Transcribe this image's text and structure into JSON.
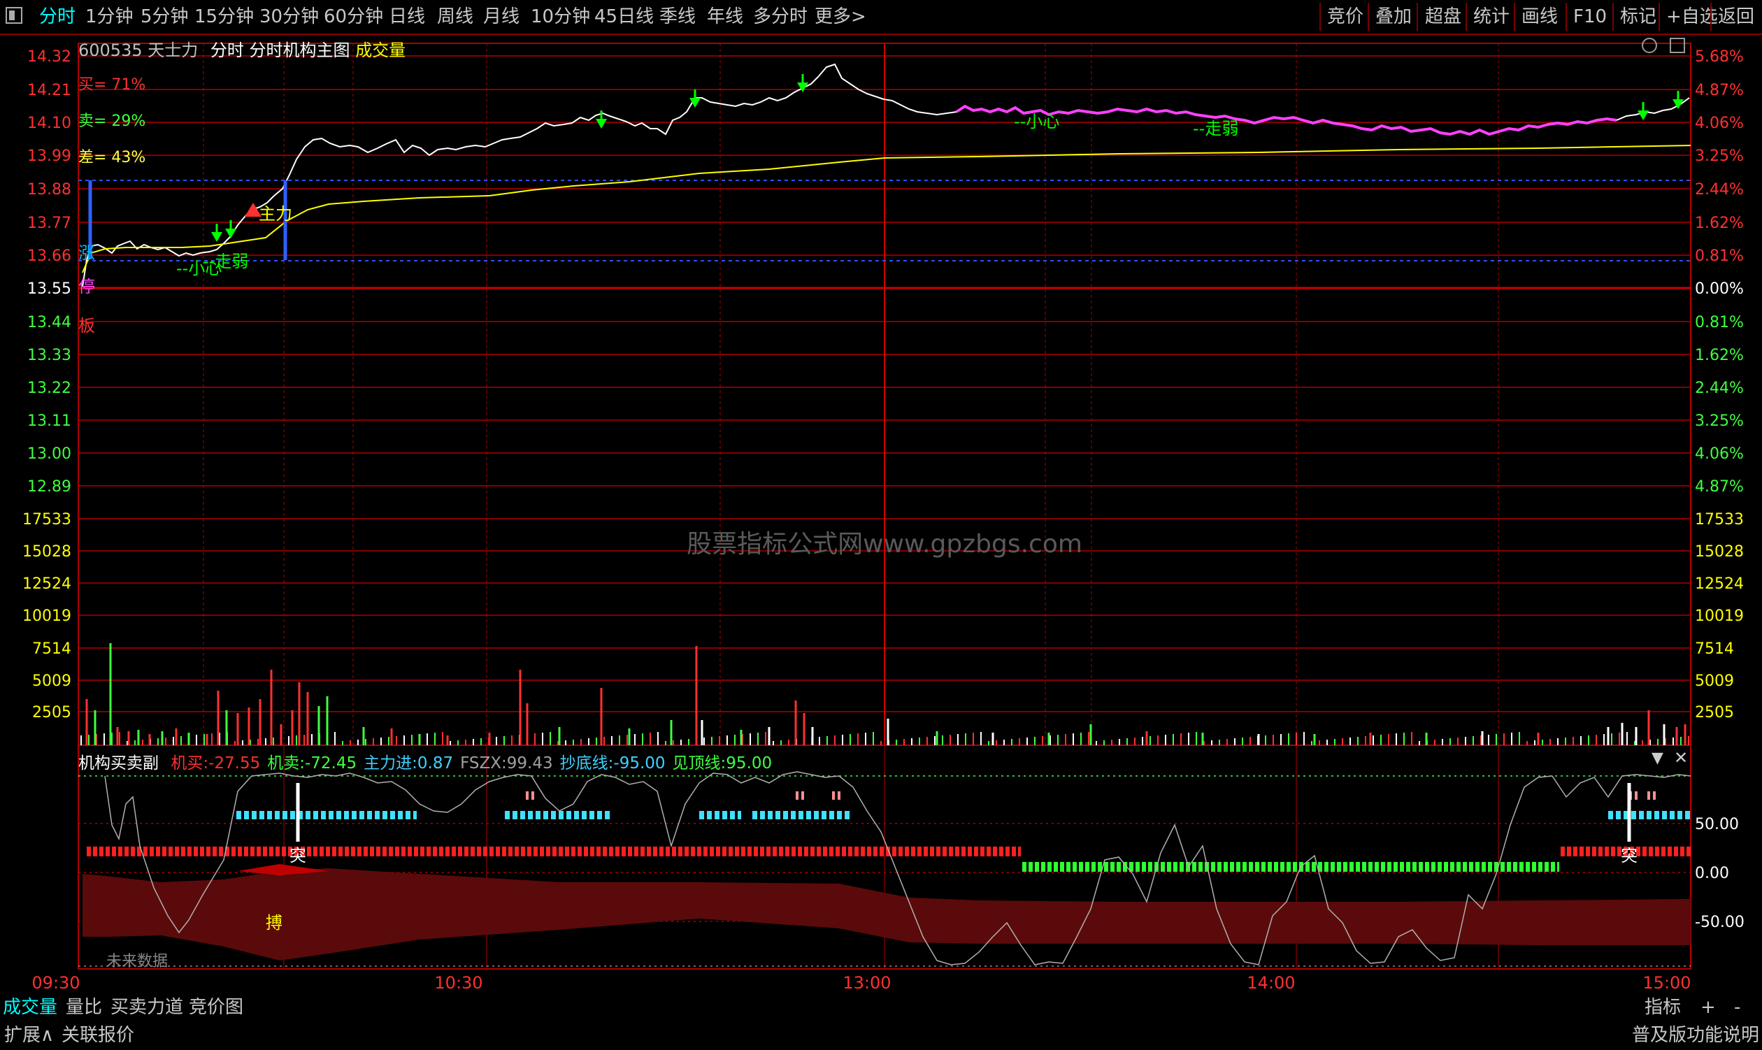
{
  "toolbar": {
    "periods": [
      "分时",
      "1分钟",
      "5分钟",
      "15分钟",
      "30分钟",
      "60分钟",
      "日线",
      "周线",
      "月线",
      "10分钟",
      "45日线",
      "季线",
      "年线",
      "多分时",
      "更多>"
    ],
    "right_buttons": [
      "竞价",
      "叠加",
      "超盘",
      "统计",
      "画线",
      "F10",
      "标记",
      "+自选",
      "返回"
    ]
  },
  "header": {
    "code": "600535",
    "name": "天士力",
    "mode": "分时",
    "indicator_name": "分时机构主图",
    "volume_label": "成交量"
  },
  "main_chart": {
    "stats": [
      {
        "text": "买= 71%",
        "color": "#ff3030"
      },
      {
        "text": "卖= 29%",
        "color": "#40ff40"
      },
      {
        "text": "差= 43%",
        "color": "#ffff40"
      }
    ],
    "price_ticks": [
      "14.32",
      "14.21",
      "14.10",
      "13.99",
      "13.88",
      "13.77",
      "13.66",
      "13.55",
      "13.44",
      "13.33",
      "13.22",
      "13.11",
      "13.00",
      "12.89"
    ],
    "pct_ticks": [
      "5.68%",
      "4.87%",
      "4.06%",
      "3.25%",
      "2.44%",
      "1.62%",
      "0.81%",
      "0.00%",
      "0.81%",
      "1.62%",
      "2.44%",
      "3.25%",
      "4.06%",
      "4.87%"
    ],
    "price_range": [
      12.89,
      14.32
    ],
    "prev_close": 13.55,
    "annotations": [
      {
        "text": "--小心",
        "color": "#00ff00"
      },
      {
        "text": "--走弱",
        "color": "#00ff00"
      },
      {
        "text": "主力",
        "color": "#ffff00"
      },
      {
        "text": "--小心",
        "color": "#00ff00"
      },
      {
        "text": "--走弱",
        "color": "#00ff00"
      }
    ],
    "side_marks": [
      {
        "text": "涨",
        "color": "#00c0ff"
      },
      {
        "text": "停",
        "color": "#ff40ff"
      },
      {
        "text": "板",
        "color": "#ff3030"
      }
    ],
    "watermark": "股票指标公式网www.gpzbgs.com"
  },
  "volume_chart": {
    "ticks": [
      "17533",
      "15028",
      "12524",
      "10019",
      "7514",
      "5009",
      "2505"
    ]
  },
  "indicator": {
    "name": "机构买卖副",
    "items": [
      {
        "label": "机买:",
        "value": "-27.55",
        "color": "#ff3030"
      },
      {
        "label": "机卖:",
        "value": "-72.45",
        "color": "#40ff40"
      },
      {
        "label": "主力进:",
        "value": "0.87",
        "color": "#40d0ff"
      },
      {
        "label": "FSZX:",
        "value": "99.43",
        "color": "#a0a0a0"
      },
      {
        "label": "抄底线:",
        "value": "-95.00",
        "color": "#40d0ff"
      },
      {
        "label": "见顶线:",
        "value": "95.00",
        "color": "#40ff40"
      }
    ],
    "ticks": [
      "50.00",
      "0.00",
      "-50.00"
    ],
    "marks": [
      {
        "text": "突",
        "color": "#ffffff"
      },
      {
        "text": "突",
        "color": "#ffffff"
      },
      {
        "text": "搏",
        "color": "#ffff00"
      }
    ],
    "future_text": "未来数据"
  },
  "time_axis": [
    "09:30",
    "10:30",
    "13:00",
    "14:00",
    "15:00"
  ],
  "bottom_tabs": [
    "成交量",
    "量比",
    "买卖力道",
    "竞价图"
  ],
  "bottom_right": [
    "指标",
    "+",
    "-"
  ],
  "bottom_row2_left": [
    "扩展∧",
    "关联报价"
  ],
  "bottom_row2_right": "普及版功能说明"
}
